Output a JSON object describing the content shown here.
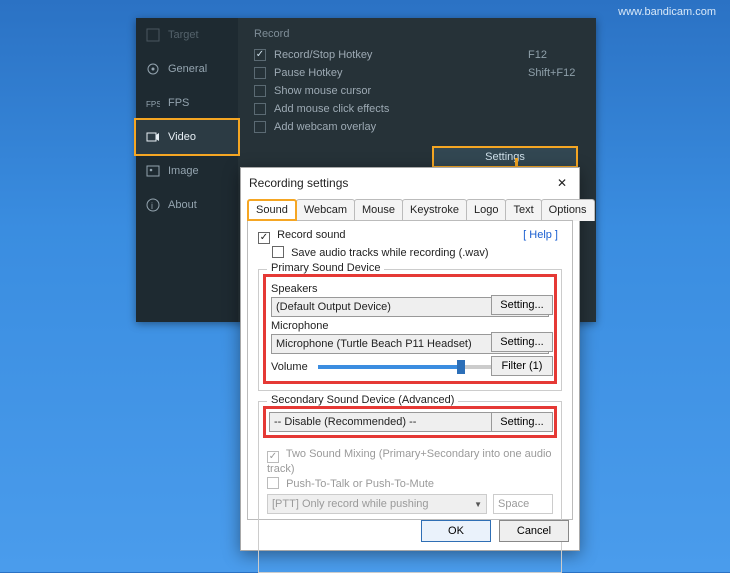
{
  "watermark": "www.bandicam.com",
  "sidebar": {
    "items": [
      {
        "label": "Target",
        "icon": "target-icon"
      },
      {
        "label": "General",
        "icon": "gear-icon"
      },
      {
        "label": "FPS",
        "icon": "fps-icon"
      },
      {
        "label": "Video",
        "icon": "video-icon"
      },
      {
        "label": "Image",
        "icon": "image-icon"
      },
      {
        "label": "About",
        "icon": "info-icon"
      }
    ]
  },
  "main": {
    "section": "Record",
    "rows": [
      {
        "label": "Record/Stop Hotkey",
        "hotkey": "F12",
        "checked": true
      },
      {
        "label": "Pause Hotkey",
        "hotkey": "Shift+F12",
        "checked": false
      },
      {
        "label": "Show mouse cursor",
        "hotkey": "",
        "checked": false
      },
      {
        "label": "Add mouse click effects",
        "hotkey": "",
        "checked": false
      },
      {
        "label": "Add webcam overlay",
        "hotkey": "",
        "checked": false
      }
    ],
    "settings_btn": "Settings"
  },
  "dialog": {
    "title": "Recording settings",
    "tabs": [
      "Sound",
      "Webcam",
      "Mouse",
      "Keystroke",
      "Logo",
      "Text",
      "Options"
    ],
    "active_tab": "Sound",
    "record_sound": "Record sound",
    "save_wav": "Save audio tracks while recording (.wav)",
    "help": "[ Help ]",
    "primary_title": "Primary Sound Device",
    "speakers_label": "Speakers",
    "speakers_value": "(Default Output Device)",
    "mic_label": "Microphone",
    "mic_value": "Microphone (Turtle Beach P11 Headset)",
    "setting_btn": "Setting...",
    "volume_label": "Volume",
    "volume_pct": "80%",
    "volume_value": 80,
    "filter_btn": "Filter (1)",
    "secondary_title": "Secondary Sound Device (Advanced)",
    "secondary_value": "-- Disable (Recommended) --",
    "two_mix": "Two Sound Mixing (Primary+Secondary into one audio track)",
    "ptt": "Push-To-Talk or Push-To-Mute",
    "ptt_mode": "[PTT] Only record while pushing",
    "ptt_key": "Space",
    "ok": "OK",
    "cancel": "Cancel"
  }
}
